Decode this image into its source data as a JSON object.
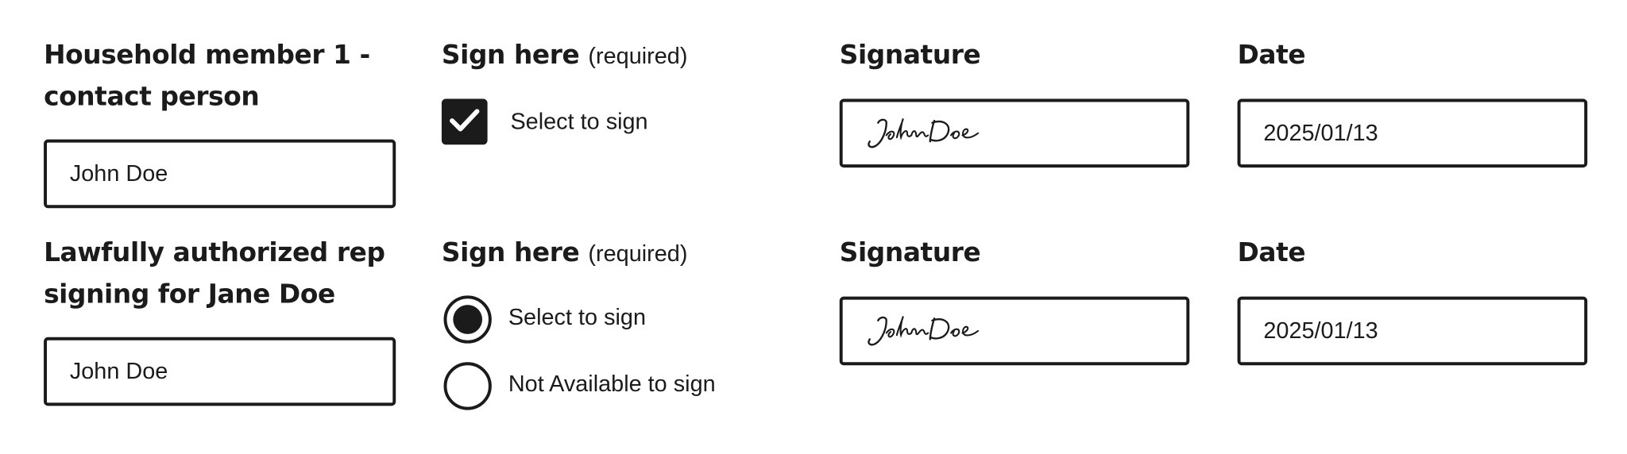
{
  "rows": [
    {
      "member_heading": "Household member 1 - contact person",
      "member_name": "John Doe",
      "sign_heading": "Sign here",
      "sign_required": "(required)",
      "sign_option_label": "Select to sign",
      "signature_heading": "Signature",
      "signature_value": "John Doe",
      "date_heading": "Date",
      "date_value": "2025/01/13"
    },
    {
      "member_heading": "Lawfully authorized rep signing for Jane Doe",
      "member_name": "John Doe",
      "sign_heading": "Sign here",
      "sign_required": "(required)",
      "options": [
        {
          "label": "Select to sign",
          "selected": true
        },
        {
          "label": "Not Available to sign",
          "selected": false
        }
      ],
      "signature_heading": "Signature",
      "signature_value": "John Doe",
      "date_heading": "Date",
      "date_value": "2025/01/13"
    }
  ],
  "icons": {
    "checkbox_checked": "checkmark-icon",
    "signature": "handwritten-signature-icon"
  },
  "colors": {
    "ink": "#1b1b1b",
    "background": "#ffffff"
  }
}
